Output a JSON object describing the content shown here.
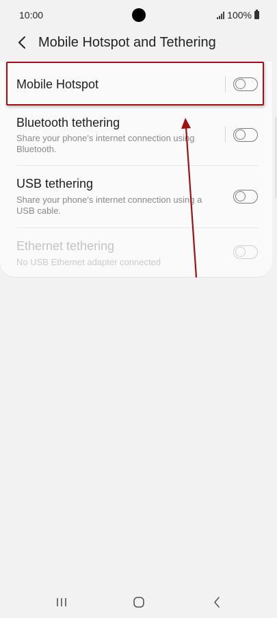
{
  "status_bar": {
    "time": "10:00",
    "battery_text": "100%"
  },
  "header": {
    "title": "Mobile Hotspot and Tethering",
    "back_icon": "chevron-left-icon"
  },
  "rows": [
    {
      "title": "Mobile Hotspot",
      "subtitle": "",
      "toggle_on": false,
      "enabled": true
    },
    {
      "title": "Bluetooth tethering",
      "subtitle": "Share your phone's internet connection using Bluetooth.",
      "toggle_on": false,
      "enabled": true
    },
    {
      "title": "USB tethering",
      "subtitle": "Share your phone's internet connection using a USB cable.",
      "toggle_on": false,
      "enabled": true
    },
    {
      "title": "Ethernet tethering",
      "subtitle": "No USB Ethernet adapter connected",
      "toggle_on": false,
      "enabled": false
    }
  ],
  "nav_bar": {
    "icons": [
      "recents-icon",
      "home-icon",
      "back-icon"
    ]
  },
  "colors": {
    "annotation": "#a30f0f",
    "background": "#f2f2f2",
    "card": "#fafafa"
  }
}
